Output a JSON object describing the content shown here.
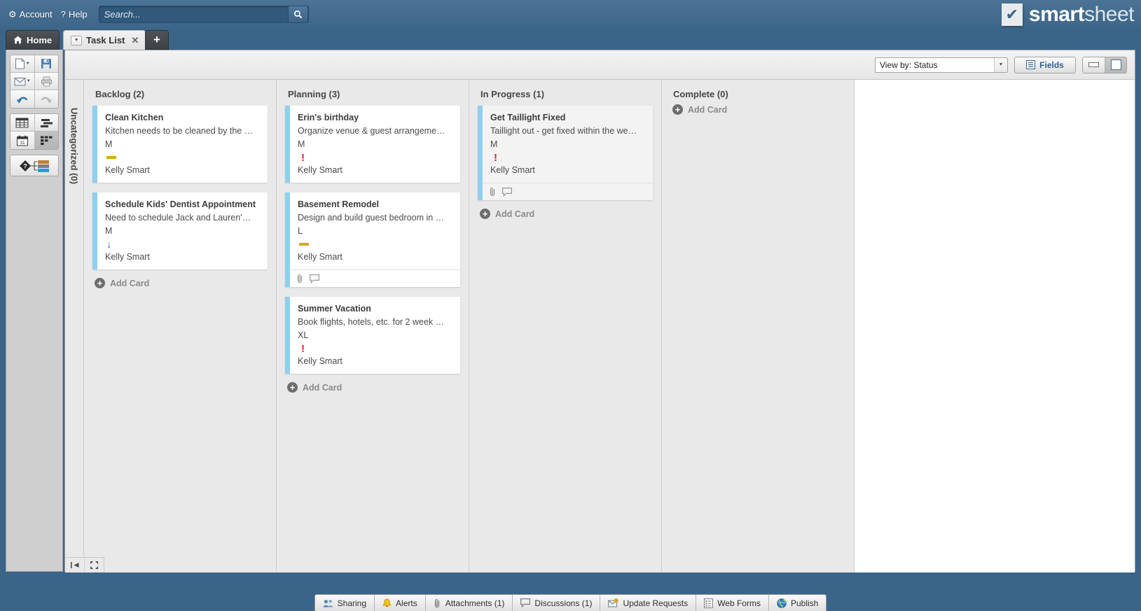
{
  "topbar": {
    "account_label": "Account",
    "help_label": "Help",
    "account_icon": "gear-icon",
    "help_icon": "question-mark-icon",
    "search_placeholder": "Search...",
    "search_value": "",
    "search_icon": "search-icon",
    "logo_primary": "smart",
    "logo_secondary": "sheet",
    "logo_check": "✔"
  },
  "tabs": {
    "home_label": "Home",
    "home_icon": "home-icon",
    "sheet_label": "Task List",
    "sheet_menu_icon": "chevron-down-icon",
    "sheet_close_icon": "close-icon",
    "add_label": "+"
  },
  "toolbar": {
    "groups": [
      {
        "rows": [
          [
            {
              "name": "new-sheet-button",
              "icon": "document-icon",
              "caret": true
            },
            {
              "name": "save-button",
              "icon": "floppy-disk-icon",
              "caret": false
            }
          ],
          [
            {
              "name": "send-email-button",
              "icon": "envelope-icon",
              "caret": true
            },
            {
              "name": "print-button",
              "icon": "printer-icon",
              "caret": false
            }
          ],
          [
            {
              "name": "undo-button",
              "icon": "undo-arrow-icon",
              "caret": false
            },
            {
              "name": "redo-button",
              "icon": "redo-arrow-icon",
              "caret": false
            }
          ]
        ]
      },
      {
        "rows": [
          [
            {
              "name": "grid-view-button",
              "icon": "grid-icon",
              "caret": false
            },
            {
              "name": "gantt-view-button",
              "icon": "gantt-bars-icon",
              "caret": false
            }
          ],
          [
            {
              "name": "calendar-view-button",
              "icon": "calendar-icon",
              "caret": false
            },
            {
              "name": "card-view-button",
              "icon": "card-view-icon",
              "caret": false,
              "active": true
            }
          ]
        ]
      },
      {
        "rows": [
          [
            {
              "name": "conditional-formatting-button",
              "icon": "conditional-format-icon",
              "caret": false
            }
          ]
        ]
      }
    ]
  },
  "viewbar": {
    "view_by_label": "View by: Status",
    "view_by_options": [
      "View by: Status"
    ],
    "view_by_arrow_icon": "chevron-down-icon",
    "fields_label": "Fields",
    "fields_icon": "fields-list-icon",
    "compact_view_icon": "compact-card-icon",
    "full_view_icon": "full-card-icon",
    "active_card_view": "full"
  },
  "board": {
    "lane_label": "Uncategorized (0)",
    "add_card_label": "Add Card",
    "add_card_icon": "plus-circle-icon",
    "attachment_icon": "paperclip-icon",
    "comment_icon": "speech-bubble-icon",
    "columns": [
      {
        "title": "Backlog (2)",
        "cards": [
          {
            "title": "Clean Kitchen",
            "description": "Kitchen needs to be cleaned by the …",
            "size": "M",
            "priority": "medium",
            "priority_color": "#d4aa00",
            "owner": "Kelly Smart",
            "has_footer": false,
            "highlighted": false
          },
          {
            "title": "Schedule Kids' Dentist Appointment",
            "description": "Need to schedule Jack and Lauren'…",
            "size": "M",
            "priority": "low",
            "priority_color": "#1f6fc4",
            "owner": "Kelly Smart",
            "has_footer": false,
            "highlighted": false
          }
        ]
      },
      {
        "title": "Planning (3)",
        "cards": [
          {
            "title": "Erin's birthday",
            "description": "Organize venue & guest arrangeme…",
            "size": "M",
            "priority": "high",
            "priority_color": "#e02020",
            "owner": "Kelly Smart",
            "has_footer": false,
            "highlighted": false
          },
          {
            "title": "Basement Remodel",
            "description": "Design and build guest bedroom in …",
            "size": "L",
            "priority": "medium",
            "priority_color": "#d4aa00",
            "owner": "Kelly Smart",
            "has_footer": true,
            "highlighted": false
          },
          {
            "title": "Summer Vacation",
            "description": "Book flights, hotels, etc. for 2 week …",
            "size": "XL",
            "priority": "high",
            "priority_color": "#e02020",
            "owner": "Kelly Smart",
            "has_footer": false,
            "highlighted": false
          }
        ]
      },
      {
        "title": "In Progress (1)",
        "cards": [
          {
            "title": "Get Taillight Fixed",
            "description": "Taillight out - get fixed within the we…",
            "size": "M",
            "priority": "high",
            "priority_color": "#e02020",
            "owner": "Kelly Smart",
            "has_footer": true,
            "highlighted": true
          }
        ]
      },
      {
        "title": "Complete (0)",
        "cards": []
      }
    ]
  },
  "minibuttons": {
    "collapse_icon": "collapse-left-icon",
    "fullscreen_icon": "expand-arrows-icon"
  },
  "statusbar": {
    "items": [
      {
        "name": "sharing",
        "label": "Sharing",
        "icon": "people-icon"
      },
      {
        "name": "alerts",
        "label": "Alerts",
        "icon": "bell-icon"
      },
      {
        "name": "attachments",
        "label": "Attachments (1)",
        "icon": "paperclip-icon"
      },
      {
        "name": "discussions",
        "label": "Discussions (1)",
        "icon": "speech-bubble-icon"
      },
      {
        "name": "update-requests",
        "label": "Update Requests",
        "icon": "envelope-clock-icon"
      },
      {
        "name": "web-forms",
        "label": "Web Forms",
        "icon": "form-icon"
      },
      {
        "name": "publish",
        "label": "Publish",
        "icon": "globe-icon"
      }
    ]
  },
  "colors": {
    "chrome_blue": "#3b6489",
    "board_gray": "#e9e9e9",
    "card_accent": "#8ed0f0",
    "link_blue": "#31618f"
  }
}
